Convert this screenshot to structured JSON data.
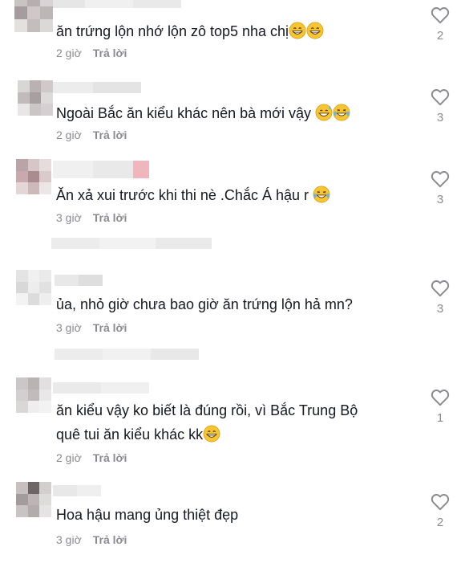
{
  "comments": [
    {
      "text": "ăn trứng lộn nhớ lộn zô top5 nha chị",
      "emojis": [
        "grin",
        "grin"
      ],
      "time": "2 giờ",
      "reply": "Trả lời",
      "likes": "2"
    },
    {
      "text": "Ngoài Bắc ăn kiểu khác nên bà mới vậy",
      "emojis": [
        "grin-sweat",
        "joy"
      ],
      "time": "2 giờ",
      "reply": "Trả lời",
      "likes": "3"
    },
    {
      "text": "Ăn xả xui trước khi thi nè .Chắc Á hậu r",
      "emojis": [
        "joy"
      ],
      "time": "3 giờ",
      "reply": "Trả lời",
      "likes": "3"
    },
    {
      "text": "ủa, nhỏ giờ chưa bao giờ ăn trứng lộn hả mn?",
      "emojis": [],
      "time": "3 giờ",
      "reply": "Trả lời",
      "likes": "3"
    },
    {
      "text_line1": "ăn kiểu vậy ko biết là đúng rồi, vì Bắc Trung Bộ",
      "text_line2": "quê tui ăn kiểu khác kk",
      "emojis": [
        "grin"
      ],
      "time": "2 giờ",
      "reply": "Trả lời",
      "likes": "1"
    },
    {
      "text": "Hoa hậu mang ủng thiệt đẹp",
      "emojis": [],
      "time": "3 giờ",
      "reply": "Trả lời",
      "likes": "2"
    }
  ],
  "icons": {
    "like": "heart-outline-icon"
  },
  "colors": {
    "text": "#161823",
    "meta": "#8a8b91",
    "heart": "#8a8b91"
  }
}
